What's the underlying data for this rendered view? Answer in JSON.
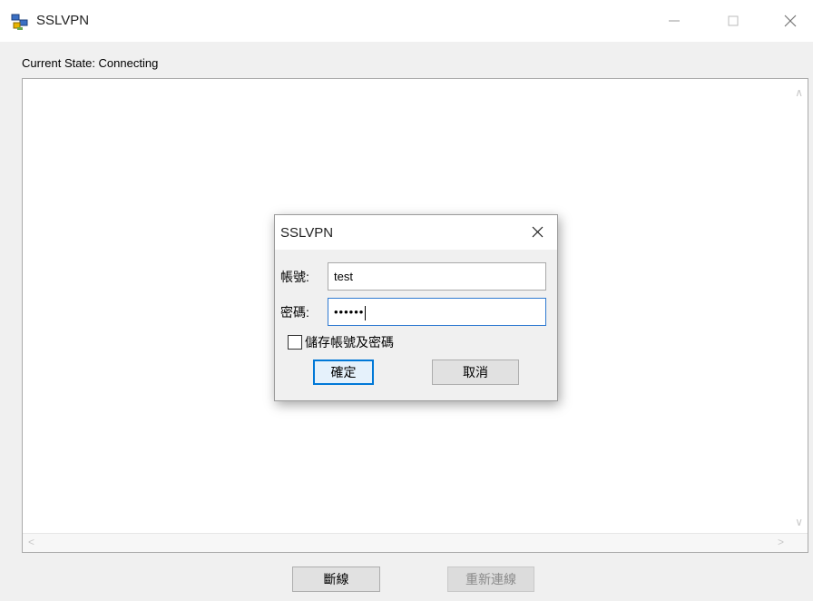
{
  "window": {
    "title": "SSLVPN",
    "icon": "network-computers-icon",
    "controls": {
      "minimize": "minimize-icon",
      "maximize": "maximize-icon",
      "close": "close-icon"
    }
  },
  "status": {
    "text": "Current State: Connecting"
  },
  "log": {
    "content": ""
  },
  "buttons": {
    "disconnect": "斷線",
    "reconnect": "重新連線"
  },
  "dialog": {
    "title": "SSLVPN",
    "username_label": "帳號:",
    "username_value": "test",
    "password_label": "密碼:",
    "password_value": "••••••",
    "remember_label": "儲存帳號及密碼",
    "remember_checked": false,
    "ok_label": "確定",
    "cancel_label": "取消"
  },
  "colors": {
    "accent": "#0078d7",
    "focus_border": "#2f7ad1"
  }
}
